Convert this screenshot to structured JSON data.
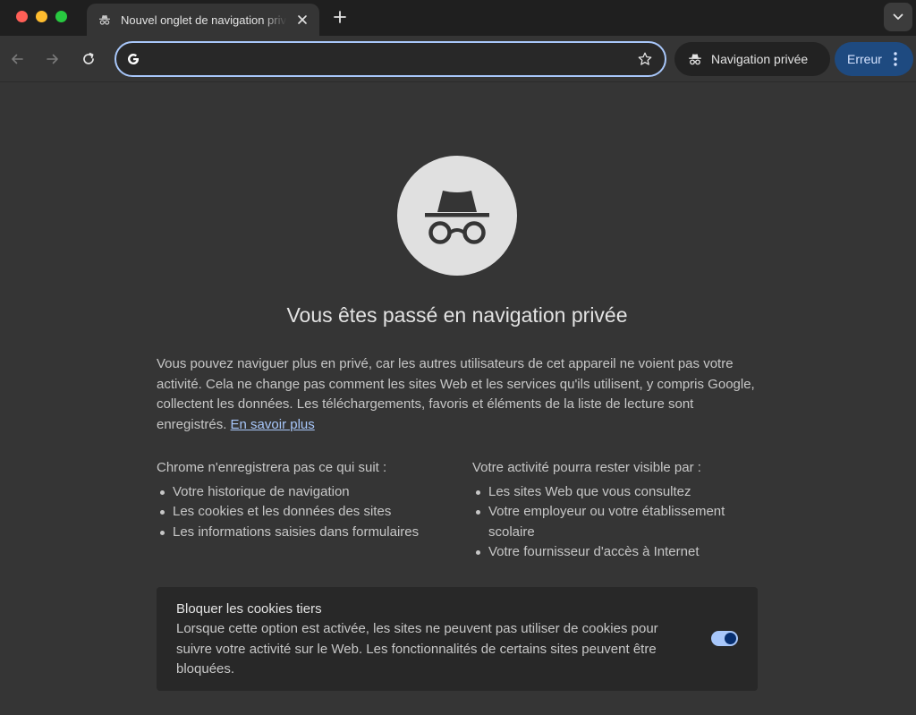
{
  "tab": {
    "title": "Nouvel onglet de navigation privée"
  },
  "omnibox": {
    "value": "",
    "placeholder": ""
  },
  "toolbar": {
    "incognito_label": "Navigation privée",
    "error_label": "Erreur"
  },
  "content": {
    "headline": "Vous êtes passé en navigation privée",
    "intro_text": "Vous pouvez naviguer plus en privé, car les autres utilisateurs de cet appareil ne voient pas votre activité. Cela ne change pas comment les sites Web et les services qu'ils utilisent, y compris Google, collectent les données. Les téléchargements, favoris et éléments de la liste de lecture sont enregistrés.",
    "learn_more": "En savoir plus",
    "not_saved": {
      "title": "Chrome n'enregistrera pas ce qui suit :",
      "items": [
        "Votre historique de navigation",
        "Les cookies et les données des sites",
        "Les informations saisies dans formulaires"
      ]
    },
    "may_be_visible": {
      "title": "Votre activité pourra rester visible par :",
      "items": [
        "Les sites Web que vous consultez",
        "Votre employeur ou votre établissement scolaire",
        "Votre fournisseur d'accès à Internet"
      ]
    },
    "cookie_card": {
      "title": "Bloquer les cookies tiers",
      "description": "Lorsque cette option est activée, les sites ne peuvent pas utiliser de cookies pour suivre votre activité sur le Web. Les fonctionnalités de certains sites peuvent être bloquées.",
      "toggle_on": true
    }
  },
  "icons": {
    "close_window": "red-dot",
    "minimize_window": "yellow-dot",
    "maximize_window": "green-dot",
    "tab_favicon": "incognito-icon",
    "tab_close": "close-icon",
    "new_tab": "plus-icon",
    "tab_search": "chevron-down-icon",
    "back": "arrow-left-icon",
    "forward": "arrow-right-icon",
    "reload": "reload-icon",
    "search_engine": "google-g-icon",
    "bookmark": "star-icon",
    "menu": "kebab-icon"
  },
  "colors": {
    "accent": "#a8c7fa",
    "error_chip": "#1e4a80",
    "background": "#353535"
  }
}
